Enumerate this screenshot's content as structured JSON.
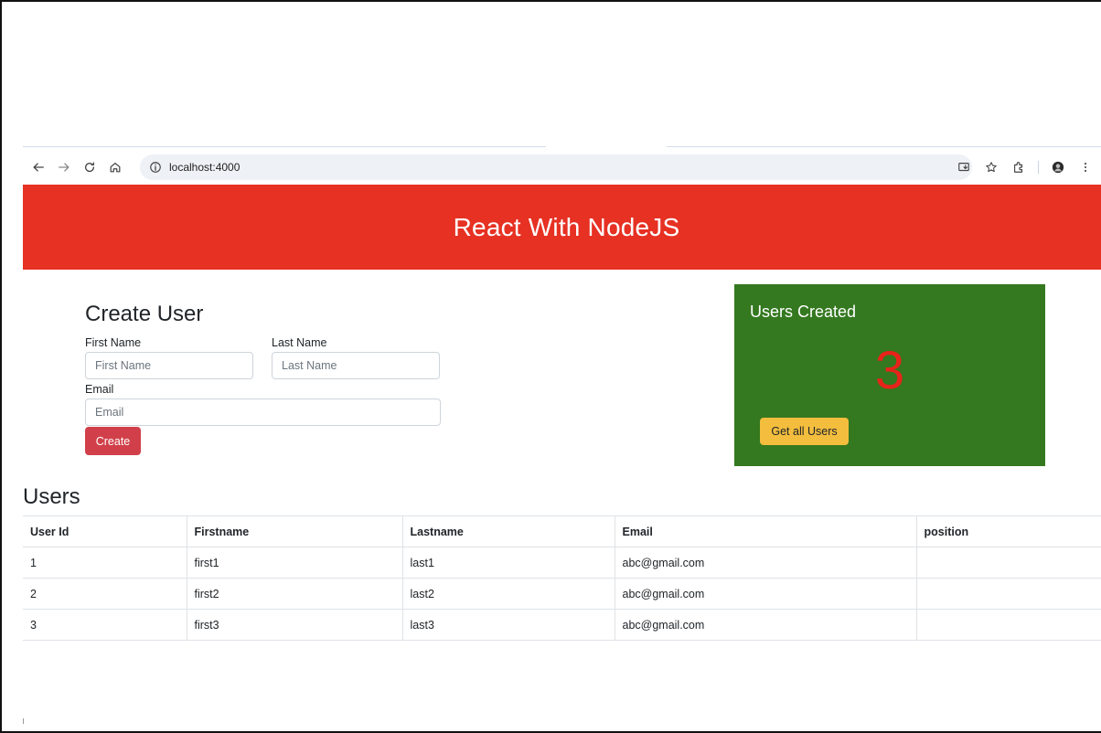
{
  "browser": {
    "url": "localhost:4000",
    "icons": [
      "back-icon",
      "forward-icon",
      "reload-icon",
      "home-icon",
      "info-icon",
      "install-icon",
      "star-icon",
      "extensions-icon",
      "profile-icon",
      "menu-icon"
    ]
  },
  "header": {
    "title": "React With NodeJS",
    "background": "#e63123"
  },
  "form": {
    "title": "Create User",
    "first_name_label": "First Name",
    "first_name_placeholder": "First Name",
    "first_name_value": "",
    "last_name_label": "Last Name",
    "last_name_placeholder": "Last Name",
    "last_name_value": "",
    "email_label": "Email",
    "email_placeholder": "Email",
    "email_value": "",
    "submit_label": "Create"
  },
  "stats": {
    "title": "Users Created",
    "count": "3",
    "button_label": "Get all Users",
    "background": "#34781f",
    "count_color": "#e8231a"
  },
  "users": {
    "title": "Users",
    "columns": [
      "User Id",
      "Firstname",
      "Lastname",
      "Email",
      "position"
    ],
    "rows": [
      [
        "1",
        "first1",
        "last1",
        "abc@gmail.com",
        ""
      ],
      [
        "2",
        "first2",
        "last2",
        "abc@gmail.com",
        ""
      ],
      [
        "3",
        "first3",
        "last3",
        "abc@gmail.com",
        ""
      ]
    ]
  }
}
